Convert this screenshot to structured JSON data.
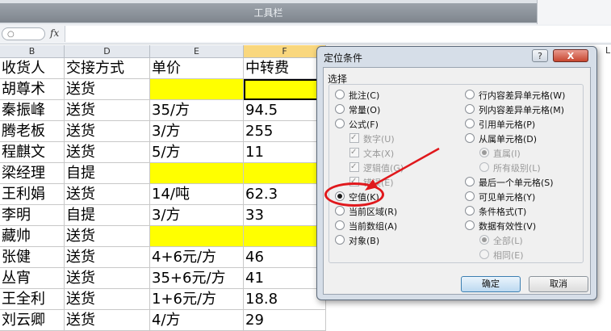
{
  "toolbar": {
    "title": "工具栏"
  },
  "formula_bar": {
    "fx_label": "fx"
  },
  "columns": [
    {
      "letter": "B"
    },
    {
      "letter": "D"
    },
    {
      "letter": "E"
    },
    {
      "letter": "F"
    }
  ],
  "right_edge_letter": "L",
  "rows": [
    {
      "b": "收货人",
      "d": "交接方式",
      "e": "单价",
      "f": "中转费"
    },
    {
      "b": "胡尊术",
      "d": "送货",
      "e": "",
      "f": ""
    },
    {
      "b": "秦振峰",
      "d": "送货",
      "e": "35/方",
      "f": "94.5"
    },
    {
      "b": "腾老板",
      "d": "送货",
      "e": "3/方",
      "f": "255"
    },
    {
      "b": "程麒文",
      "d": "送货",
      "e": "5/方",
      "f": "11"
    },
    {
      "b": "梁经理",
      "d": "自提",
      "e": "",
      "f": ""
    },
    {
      "b": "王利娟",
      "d": "送货",
      "e": "14/吨",
      "f": "62.3"
    },
    {
      "b": "李明",
      "d": "自提",
      "e": "3/方",
      "f": "33"
    },
    {
      "b": "藏帅",
      "d": "送货",
      "e": "",
      "f": ""
    },
    {
      "b": "张健",
      "d": "送货",
      "e": "4+6元/方",
      "f": "46"
    },
    {
      "b": "丛宵",
      "d": "送货",
      "e": "35+6元/方",
      "f": "41"
    },
    {
      "b": "王全利",
      "d": "送货",
      "e": "1+6元/方",
      "f": "18.8"
    },
    {
      "b": "刘云卿",
      "d": "送货",
      "e": "4/方",
      "f": "29"
    }
  ],
  "dialog": {
    "title": "定位条件",
    "help": "?",
    "close": "X",
    "group": "选择",
    "left_options": {
      "comments": "批注(C)",
      "constants": "常量(O)",
      "formulas": "公式(F)",
      "numbers": "数字(U)",
      "text": "文本(X)",
      "logicals": "逻辑值(G)",
      "errors": "错误(E)",
      "blanks": "空值(K)",
      "current_region": "当前区域(R)",
      "current_array": "当前数组(A)",
      "objects": "对象(B)"
    },
    "right_options": {
      "row_diff": "行内容差异单元格(W)",
      "col_diff": "列内容差异单元格(M)",
      "precedents": "引用单元格(P)",
      "dependents": "从属单元格(D)",
      "direct_only": "直属(I)",
      "all_levels": "所有级别(L)",
      "last_cell": "最后一个单元格(S)",
      "visible_cells": "可见单元格(Y)",
      "conditional_formats": "条件格式(T)",
      "data_validation": "数据有效性(V)",
      "all": "全部(L)",
      "same": "相同(E)"
    },
    "ok": "确定",
    "cancel": "取消"
  },
  "colors": {
    "highlight": "#ffff00",
    "annotation": "#e0181c"
  }
}
